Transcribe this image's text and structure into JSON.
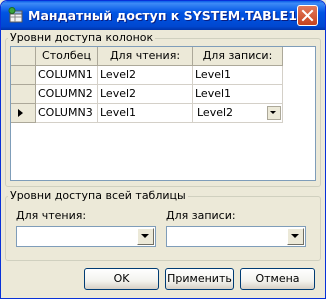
{
  "window": {
    "title": "Мандатный доступ к SYSTEM.TABLE1"
  },
  "column_group": {
    "label": "Уровни доступа колонок",
    "headers": [
      "Столбец",
      "Для чтения:",
      "Для записи:"
    ],
    "rows": [
      {
        "column": "COLUMN1",
        "read": "Level2",
        "write": "Level1"
      },
      {
        "column": "COLUMN2",
        "read": "Level2",
        "write": "Level1"
      },
      {
        "column": "COLUMN3",
        "read": "Level1",
        "write": "Level2"
      }
    ],
    "current_row": 3
  },
  "table_group": {
    "label": "Уровни доступа всей таблицы",
    "read_label": "Для чтения:",
    "read_value": "",
    "write_label": "Для записи:",
    "write_value": ""
  },
  "buttons": {
    "ok": "OK",
    "apply": "Применить",
    "cancel": "Отмена"
  },
  "colors": {
    "titlebar": "#0054e3",
    "face": "#ece9d8",
    "close_button": "#c8431e"
  }
}
